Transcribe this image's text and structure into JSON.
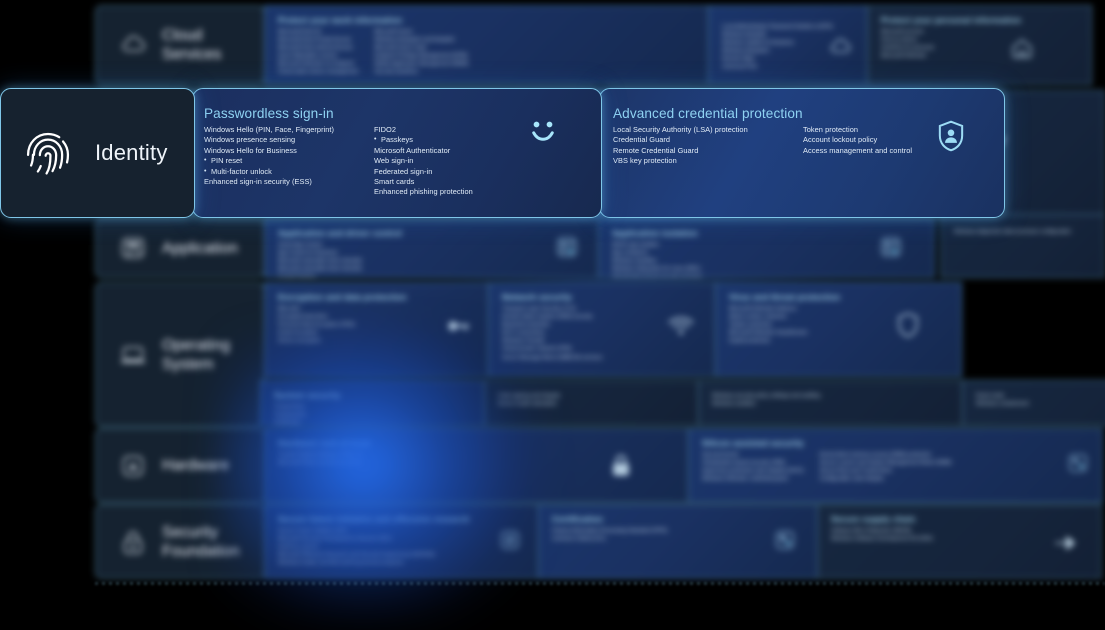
{
  "meta": {
    "background_color": "#000000",
    "accent_color": "#7fc6e8",
    "title_color": "#8fd2f2",
    "panel_color": "#1d3568",
    "label_panel_color": "#16222f"
  },
  "stack": {
    "rows": [
      {
        "id": "cloud-services",
        "label": "Cloud\nServices",
        "label_line_1": "Cloud",
        "label_line_2": "Services",
        "icon": "cloud-icon",
        "panes": [
          {
            "title": "Protect your work information",
            "icon": "cloud-icon",
            "columns": [
              [
                "Microsoft Entra ID",
                "Microsoft Entra Private Access",
                "Microsoft Entra Internet Access",
                "Azure Attestation service",
                "Microsoft Defender for Endpoint",
                "Cloud-native device management"
              ],
              [
                "Microsoft Intune",
                "Windows Autopatch and Autopilot",
                "Microsoft Intune Suite",
                "Endpoint Privilege Management (EPM)",
                "Mobile Application Management (MAM)",
                "Security baselines"
              ],
              [
                "Local Administrator Password Solution (LAPS)",
                "Windows Autopilot",
                "Windows Update for Business",
                "Windows Autopatch",
                "Remote Wipe",
                "Universal Print"
              ]
            ]
          },
          {
            "title": "Protect your personal information",
            "icon": "home-icon",
            "columns": [
              [
                "Microsoft account",
                "Find my device",
                "OneDrive for personal",
                "Microsoft Defender"
              ]
            ]
          }
        ]
      },
      {
        "id": "identity",
        "label_line_1": "Identity",
        "icon": "fingerprint-icon",
        "focused": true
      },
      {
        "id": "application",
        "label_line_1": "Application",
        "icon": "application-icon",
        "panes": [
          {
            "title": "Application and driver control",
            "icon": "app-control-icon",
            "columns": [
              [
                "Smart App Control",
                "App Control for Business",
                "Microsoft vulnerable driver blocklist",
                "Microsoft vulnerable driver blocklist",
                "Trusted Signing"
              ]
            ]
          },
          {
            "title": "Application isolation",
            "icon": "app-isolation-icon",
            "columns": [
              [
                "Win32 app isolation",
                "App containers",
                "Windows Sandbox",
                "Windows Subsystem for Linux (WSL)",
                "Virtualization-based security enclaves"
              ]
            ]
          }
        ]
      },
      {
        "id": "operating-system",
        "label_line_1": "Operating",
        "label_line_2": "System",
        "icon": "laptop-icon",
        "panes": [
          {
            "title": "Encryption and data protection",
            "icon": "key-icon",
            "columns": [
              [
                "BitLocker",
                "Encrypted hard drive",
                "Personal Data Encryption (PDE)",
                "Email encryption",
                "Device encryption"
              ]
            ]
          },
          {
            "title": "Network security",
            "icon": "wifi-icon",
            "columns": [
              [
                "Transport Layer Security (TLS)",
                "Domain Name System (DNS) security",
                "Bluetooth protection",
                "Wi-Fi connections",
                "Windows Firewall",
                "Virtual private network (VPN)",
                "Server Message Block (SMB) file services"
              ]
            ]
          },
          {
            "title": "Virus and threat protection",
            "icon": "shield-icon",
            "columns": [
              [
                "Microsoft Defender Antivirus",
                "Attack surface reduction",
                "Tamper protection",
                "Microsoft Defender SmartScreen",
                "Exploit protection"
              ]
            ]
          },
          {
            "title": "System security",
            "icon": "system-icon",
            "columns": [
              [
                "Trusted Boot",
                "Cryptography",
                "Certificates"
              ],
              [
                "Code signing and integrity",
                "Device health attestation"
              ],
              [
                "Windows security policy settings and auditing",
                "Windows sandbox"
              ],
              [
                "Kiosk mode",
                "Windows containment"
              ]
            ]
          }
        ]
      },
      {
        "id": "hardware",
        "label_line_1": "Hardware",
        "icon": "chip-icon",
        "panes": [
          {
            "title": "Hardware root-of-trust",
            "icon": "lock-chip-icon",
            "columns": [
              [
                "Trusted Platform Module (TPM) 2.0",
                "Microsoft Pluton security processor"
              ]
            ]
          },
          {
            "title": "Silicon assisted security",
            "icon": "silicon-icon",
            "columns": [
              [
                "Secured kernel",
                "Virtualization-based security (VBS)",
                "Hypervisor-protected code integrity (HVCI)",
                "Windows Defender credential guard"
              ],
              [
                "Kernel direct memory access (DMA) protection",
                "Secure Launch and System Management Mode (SMM)",
                "Secure Boot and Trusted Boot",
                "Configurable code integrity"
              ]
            ]
          }
        ]
      },
      {
        "id": "security-foundation",
        "label_line_1": "Security",
        "label_line_2": "Foundation",
        "icon": "padlock-icon",
        "panes": [
          {
            "title": "Secure future initiative and offensive research",
            "icon": "research-icon",
            "columns": [
              [
                "Secure Future Initiative (SFI)",
                "Microsoft Security Development Lifecycle (SDL)",
                "OneFuzz service",
                "Microsoft Offensive Research and Security Engineering (MORSE)",
                "Windows Insider and Microsoft bug bounty programs"
              ]
            ]
          },
          {
            "title": "Certification",
            "icon": "certificate-icon",
            "columns": [
              [
                "Federal Information Processing Standard (FIPS)",
                "Common Criteria (CC)"
              ]
            ]
          },
          {
            "title": "Secure supply chain",
            "icon": "supply-chain-icon",
            "columns": [
              [
                "Software Bill of Materials (SBOM)",
                "Windows Software Development Kit (SDK)"
              ]
            ]
          }
        ]
      }
    ],
    "side_column": {
      "label": "Privacy",
      "icon": "privacy-icon",
      "items": [
        "Privacy",
        "Consent",
        "Controls",
        "Windows diagnostic data processor configuration"
      ]
    }
  },
  "identity": {
    "label": "Identity",
    "icon": "fingerprint-icon",
    "pane_1": {
      "title": "Passwordless sign-in",
      "smiley_icon": "windows-hello-smiley-icon",
      "column_1": [
        {
          "text": "Windows Hello (PIN, Face, Fingerprint)",
          "bullet": false
        },
        {
          "text": "Windows presence sensing",
          "bullet": false
        },
        {
          "text": "Windows Hello for Business",
          "bullet": false
        },
        {
          "text": "PIN reset",
          "bullet": true
        },
        {
          "text": "Multi-factor unlock",
          "bullet": true
        },
        {
          "text": "Enhanced sign-in security (ESS)",
          "bullet": false
        }
      ],
      "column_2": [
        {
          "text": "FIDO2",
          "bullet": false
        },
        {
          "text": "Passkeys",
          "bullet": true
        },
        {
          "text": "Microsoft Authenticator",
          "bullet": false
        },
        {
          "text": "Web sign-in",
          "bullet": false
        },
        {
          "text": "Federated sign-in",
          "bullet": false
        },
        {
          "text": "Smart cards",
          "bullet": false
        },
        {
          "text": "Enhanced phishing protection",
          "bullet": false
        }
      ]
    },
    "pane_2": {
      "title": "Advanced credential protection",
      "shield_icon": "shield-person-icon",
      "column_1": [
        {
          "text": "Local Security Authority (LSA) protection",
          "bullet": false
        },
        {
          "text": "Credential Guard",
          "bullet": false
        },
        {
          "text": "Remote Credential Guard",
          "bullet": false
        },
        {
          "text": "VBS key protection",
          "bullet": false
        }
      ],
      "column_2": [
        {
          "text": "Token protection",
          "bullet": false
        },
        {
          "text": "Account lockout policy",
          "bullet": false
        },
        {
          "text": "Access management and control",
          "bullet": false
        }
      ]
    }
  }
}
